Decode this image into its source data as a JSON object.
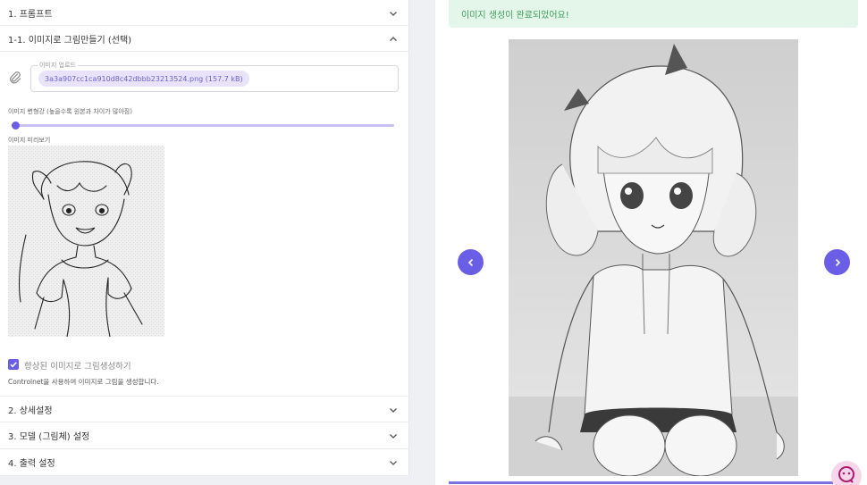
{
  "left": {
    "sections": [
      {
        "label": "1. 프롬프트",
        "expanded": false
      },
      {
        "label": "1-1. 이미지로 그림만들기 (선택)",
        "expanded": true
      },
      {
        "label": "2. 상세설정",
        "expanded": false
      },
      {
        "label": "3. 모델 (그림체) 설정",
        "expanded": false
      },
      {
        "label": "4. 출력 설정",
        "expanded": false
      }
    ],
    "upload": {
      "label": "이미지 업로드",
      "file_chip": "3a3a907cc1ca910d8c42dbbb23213524.png (157.7 kB)"
    },
    "strength": {
      "label": "이미지 변형강 (높을수록 원본과 차이가 많아짐)",
      "value": 0
    },
    "preview_label": "이미지 미리보기",
    "enhance_checkbox": {
      "label": "향상된 이미지로 그림생성하기",
      "checked": true
    },
    "helper_text": "Controlnet을 사용하여 이미지로 그림을 생성합니다."
  },
  "right": {
    "success_message": "이미지 생성이 완료되었어요!",
    "prev_icon": "chevron-left-icon",
    "next_icon": "chevron-right-icon",
    "chat_icon": "chat-bubble-icon"
  },
  "colors": {
    "accent": "#6b5ee6",
    "success_bg": "#e3f6e9",
    "success_text": "#3e9c5e"
  }
}
